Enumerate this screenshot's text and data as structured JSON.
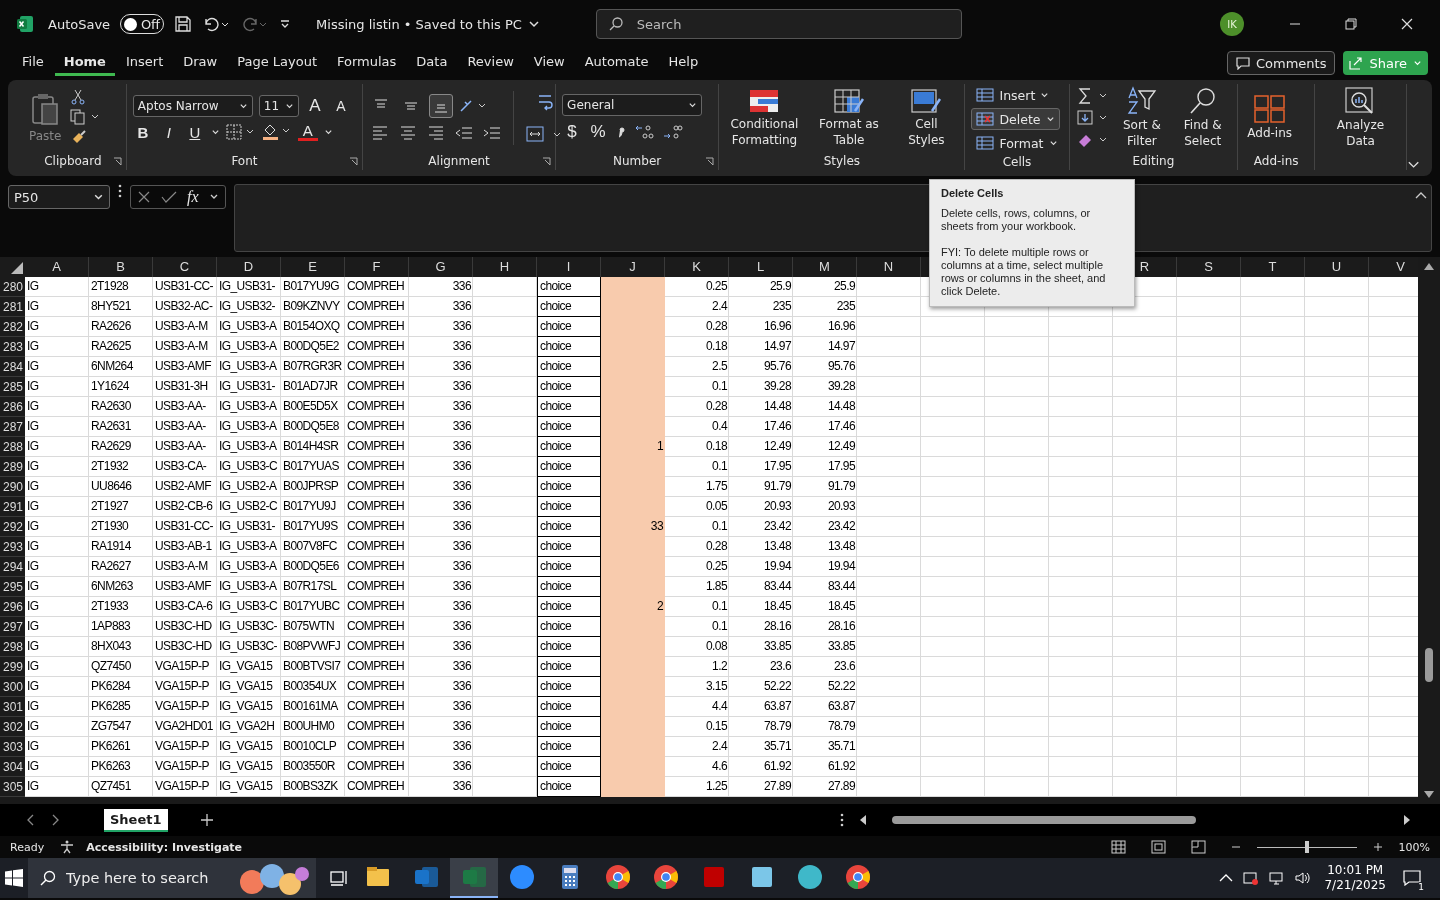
{
  "titlebar": {
    "autosave": {
      "label": "AutoSave",
      "on": false,
      "state_text": "Off"
    },
    "document": "Missing listin • Saved to this PC",
    "search_placeholder": "Search",
    "avatar": "IK"
  },
  "tabs": [
    {
      "label": "File",
      "selected": false
    },
    {
      "label": "Home",
      "selected": true
    },
    {
      "label": "Insert",
      "selected": false
    },
    {
      "label": "Draw",
      "selected": false
    },
    {
      "label": "Page Layout",
      "selected": false
    },
    {
      "label": "Formulas",
      "selected": false
    },
    {
      "label": "Data",
      "selected": false
    },
    {
      "label": "Review",
      "selected": false
    },
    {
      "label": "View",
      "selected": false
    },
    {
      "label": "Automate",
      "selected": false
    },
    {
      "label": "Help",
      "selected": false
    }
  ],
  "comments_button": "Comments",
  "share_button": "Share",
  "ribbon": {
    "clipboard": {
      "paste": "Paste",
      "title": "Clipboard"
    },
    "font": {
      "name": "Aptos Narrow",
      "size": "11",
      "grow": "A",
      "shrink": "A",
      "styles": [
        "B",
        "I",
        "U"
      ],
      "color_letter": "A",
      "title": "Font"
    },
    "alignment": {
      "vertical": [
        {
          "selected": false
        },
        {
          "selected": false
        },
        {
          "selected": true
        }
      ],
      "title": "Alignment"
    },
    "number": {
      "format": "General",
      "symbols": [
        "$",
        "%"
      ],
      "title": "Number"
    },
    "styles": {
      "items": [
        "Conditional Formatting",
        "Format as Table",
        "Cell Styles"
      ],
      "title": "Styles"
    },
    "cells": {
      "items": [
        {
          "label": "Insert",
          "hover": false
        },
        {
          "label": "Delete",
          "hover": true
        },
        {
          "label": "Format",
          "hover": false
        }
      ],
      "title": "Cells"
    },
    "editing": {
      "items": [
        "Sort & Filter",
        "Find & Select"
      ],
      "title": "Editing"
    },
    "addins": {
      "label": "Add-ins",
      "title": "Add-ins"
    },
    "analyze": {
      "label": "Analyze Data"
    }
  },
  "formula_bar": {
    "name_box": "P50",
    "fx": "fx"
  },
  "tooltip": {
    "title": "Delete Cells",
    "body": "Delete cells, rows, columns, or sheets from your workbook.",
    "note": "FYI: To delete multiple rows or columns at a time, select multiple rows or columns in the sheet, and click Delete."
  },
  "columns": [
    {
      "label": "A",
      "kind": "text"
    },
    {
      "label": "B",
      "kind": "text"
    },
    {
      "label": "C",
      "kind": "text"
    },
    {
      "label": "D",
      "kind": "text"
    },
    {
      "label": "E",
      "kind": "text"
    },
    {
      "label": "F",
      "kind": "text"
    },
    {
      "label": "G",
      "kind": "number"
    },
    {
      "label": "H",
      "kind": "text"
    },
    {
      "label": "I",
      "kind": "boxed"
    },
    {
      "label": "J",
      "kind": "shaded"
    },
    {
      "label": "K",
      "kind": "number"
    },
    {
      "label": "L",
      "kind": "number"
    },
    {
      "label": "M",
      "kind": "number"
    },
    {
      "label": "N",
      "kind": "text"
    }
  ],
  "right_columns": [
    "R",
    "S",
    "T",
    "U",
    "V"
  ],
  "rows": [
    {
      "row": "280",
      "A": "IG",
      "B": "2T1928",
      "C": "USB31-CC-",
      "D": "IG_USB31-",
      "E": "B017YU9G",
      "F": "COMPREH",
      "G": "336",
      "I": "choice",
      "K": "0.25",
      "L": "25.9",
      "M": "25.9"
    },
    {
      "row": "281",
      "A": "IG",
      "B": "8HY521",
      "C": "USB32-AC-",
      "D": "IG_USB32-",
      "E": "B09KZNVY",
      "F": "COMPREH",
      "G": "336",
      "I": "choice",
      "K": "2.4",
      "L": "235",
      "M": "235"
    },
    {
      "row": "282",
      "A": "IG",
      "B": "RA2626",
      "C": "USB3-A-M",
      "D": "IG_USB3-A",
      "E": "B0154OXQ",
      "F": "COMPREH",
      "G": "336",
      "I": "choice",
      "K": "0.28",
      "L": "16.96",
      "M": "16.96"
    },
    {
      "row": "283",
      "A": "IG",
      "B": "RA2625",
      "C": "USB3-A-M",
      "D": "IG_USB3-A",
      "E": "B00DQ5E2",
      "F": "COMPREH",
      "G": "336",
      "I": "choice",
      "K": "0.18",
      "L": "14.97",
      "M": "14.97"
    },
    {
      "row": "284",
      "A": "IG",
      "B": "6NM264",
      "C": "USB3-AMF",
      "D": "IG_USB3-A",
      "E": "B07RGR3R",
      "F": "COMPREH",
      "G": "336",
      "I": "choice",
      "K": "2.5",
      "L": "95.76",
      "M": "95.76"
    },
    {
      "row": "285",
      "A": "IG",
      "B": "1Y1624",
      "C": "USB31-3H",
      "D": "IG_USB31-",
      "E": "B01AD7JR",
      "F": "COMPREH",
      "G": "336",
      "I": "choice",
      "K": "0.1",
      "L": "39.28",
      "M": "39.28"
    },
    {
      "row": "286",
      "A": "IG",
      "B": "RA2630",
      "C": "USB3-AA-",
      "D": "IG_USB3-A",
      "E": "B00E5D5X",
      "F": "COMPREH",
      "G": "336",
      "I": "choice",
      "K": "0.28",
      "L": "14.48",
      "M": "14.48"
    },
    {
      "row": "287",
      "A": "IG",
      "B": "RA2631",
      "C": "USB3-AA-",
      "D": "IG_USB3-A",
      "E": "B00DQ5E8",
      "F": "COMPREH",
      "G": "336",
      "I": "choice",
      "K": "0.4",
      "L": "17.46",
      "M": "17.46"
    },
    {
      "row": "288",
      "A": "IG",
      "B": "RA2629",
      "C": "USB3-AA-",
      "D": "IG_USB3-A",
      "E": "B014H4SR",
      "F": "COMPREH",
      "G": "336",
      "I": "choice",
      "J": "1",
      "K": "0.18",
      "L": "12.49",
      "M": "12.49"
    },
    {
      "row": "289",
      "A": "IG",
      "B": "2T1932",
      "C": "USB3-CA-",
      "D": "IG_USB3-C",
      "E": "B017YUAS",
      "F": "COMPREH",
      "G": "336",
      "I": "choice",
      "K": "0.1",
      "L": "17.95",
      "M": "17.95"
    },
    {
      "row": "290",
      "A": "IG",
      "B": "UU8646",
      "C": "USB2-AMF",
      "D": "IG_USB2-A",
      "E": "B00JPRSP",
      "F": "COMPREH",
      "G": "336",
      "I": "choice",
      "K": "1.75",
      "L": "91.79",
      "M": "91.79"
    },
    {
      "row": "291",
      "A": "IG",
      "B": "2T1927",
      "C": "USB2-CB-6",
      "D": "IG_USB2-C",
      "E": "B017YU9J",
      "F": "COMPREH",
      "G": "336",
      "I": "choice",
      "K": "0.05",
      "L": "20.93",
      "M": "20.93"
    },
    {
      "row": "292",
      "A": "IG",
      "B": "2T1930",
      "C": "USB31-CC-",
      "D": "IG_USB31-",
      "E": "B017YU9S",
      "F": "COMPREH",
      "G": "336",
      "I": "choice",
      "J": "33",
      "K": "0.1",
      "L": "23.42",
      "M": "23.42"
    },
    {
      "row": "293",
      "A": "IG",
      "B": "RA1914",
      "C": "USB3-AB-1",
      "D": "IG_USB3-A",
      "E": "B007V8FC",
      "F": "COMPREH",
      "G": "336",
      "I": "choice",
      "K": "0.28",
      "L": "13.48",
      "M": "13.48"
    },
    {
      "row": "294",
      "A": "IG",
      "B": "RA2627",
      "C": "USB3-A-M",
      "D": "IG_USB3-A",
      "E": "B00DQ5E6",
      "F": "COMPREH",
      "G": "336",
      "I": "choice",
      "K": "0.25",
      "L": "19.94",
      "M": "19.94"
    },
    {
      "row": "295",
      "A": "IG",
      "B": "6NM263",
      "C": "USB3-AMF",
      "D": "IG_USB3-A",
      "E": "B07R17SL",
      "F": "COMPREH",
      "G": "336",
      "I": "choice",
      "K": "1.85",
      "L": "83.44",
      "M": "83.44"
    },
    {
      "row": "296",
      "A": "IG",
      "B": "2T1933",
      "C": "USB3-CA-6",
      "D": "IG_USB3-C",
      "E": "B017YUBC",
      "F": "COMPREH",
      "G": "336",
      "I": "choice",
      "J": "2",
      "K": "0.1",
      "L": "18.45",
      "M": "18.45"
    },
    {
      "row": "297",
      "A": "IG",
      "B": "1AP883",
      "C": "USB3C-HD",
      "D": "IG_USB3C-",
      "E": "B075WTN",
      "F": "COMPREH",
      "G": "336",
      "I": "choice",
      "K": "0.1",
      "L": "28.16",
      "M": "28.16"
    },
    {
      "row": "298",
      "A": "IG",
      "B": "8HX043",
      "C": "USB3C-HD",
      "D": "IG_USB3C-",
      "E": "B08PVWFJ",
      "F": "COMPREH",
      "G": "336",
      "I": "choice",
      "K": "0.08",
      "L": "33.85",
      "M": "33.85"
    },
    {
      "row": "299",
      "A": "IG",
      "B": "QZ7450",
      "C": "VGA15P-P",
      "D": "IG_VGA15",
      "E": "B00BTVSI7",
      "F": "COMPREH",
      "G": "336",
      "I": "choice",
      "K": "1.2",
      "L": "23.6",
      "M": "23.6"
    },
    {
      "row": "300",
      "A": "IG",
      "B": "PK6284",
      "C": "VGA15P-P",
      "D": "IG_VGA15",
      "E": "B00354UX",
      "F": "COMPREH",
      "G": "336",
      "I": "choice",
      "K": "3.15",
      "L": "52.22",
      "M": "52.22"
    },
    {
      "row": "301",
      "A": "IG",
      "B": "PK6285",
      "C": "VGA15P-P",
      "D": "IG_VGA15",
      "E": "B00161MA",
      "F": "COMPREH",
      "G": "336",
      "I": "choice",
      "K": "4.4",
      "L": "63.87",
      "M": "63.87"
    },
    {
      "row": "302",
      "A": "IG",
      "B": "ZG7547",
      "C": "VGA2HD01",
      "D": "IG_VGA2H",
      "E": "B00UHM0",
      "F": "COMPREH",
      "G": "336",
      "I": "choice",
      "K": "0.15",
      "L": "78.79",
      "M": "78.79"
    },
    {
      "row": "303",
      "A": "IG",
      "B": "PK6261",
      "C": "VGA15P-P",
      "D": "IG_VGA15",
      "E": "B0010CLP",
      "F": "COMPREH",
      "G": "336",
      "I": "choice",
      "K": "2.4",
      "L": "35.71",
      "M": "35.71"
    },
    {
      "row": "304",
      "A": "IG",
      "B": "PK6263",
      "C": "VGA15P-P",
      "D": "IG_VGA15",
      "E": "B003550R",
      "F": "COMPREH",
      "G": "336",
      "I": "choice",
      "K": "4.6",
      "L": "61.92",
      "M": "61.92"
    },
    {
      "row": "305",
      "A": "IG",
      "B": "QZ7451",
      "C": "VGA15P-P",
      "D": "IG_VGA15",
      "E": "B00BS3ZK",
      "F": "COMPREH",
      "G": "336",
      "I": "choice",
      "K": "1.25",
      "L": "27.89",
      "M": "27.89"
    }
  ],
  "sheet_tabs": [
    {
      "label": "Sheet1",
      "selected": true
    }
  ],
  "status_bar": {
    "mode": "Ready",
    "accessibility": "Accessibility: Investigate",
    "zoom": "100%",
    "zoom_slider": {
      "level": 0.5
    }
  },
  "taskbar": {
    "search_placeholder": "Type here to search",
    "apps": [
      {
        "kind": "explorer",
        "active": false
      },
      {
        "kind": "outlook",
        "active": false
      },
      {
        "kind": "excel",
        "active": true
      },
      {
        "kind": "zoom",
        "active": false
      },
      {
        "kind": "calculator",
        "active": false
      },
      {
        "kind": "chrome",
        "active": false
      },
      {
        "kind": "chrome",
        "active": false
      },
      {
        "kind": "filezilla",
        "active": false
      },
      {
        "kind": "notepad",
        "active": false
      },
      {
        "kind": "diamond",
        "active": false
      },
      {
        "kind": "chrome",
        "active": false
      }
    ],
    "time": "10:01 PM",
    "date": "7/21/2025",
    "notifications": "1"
  }
}
